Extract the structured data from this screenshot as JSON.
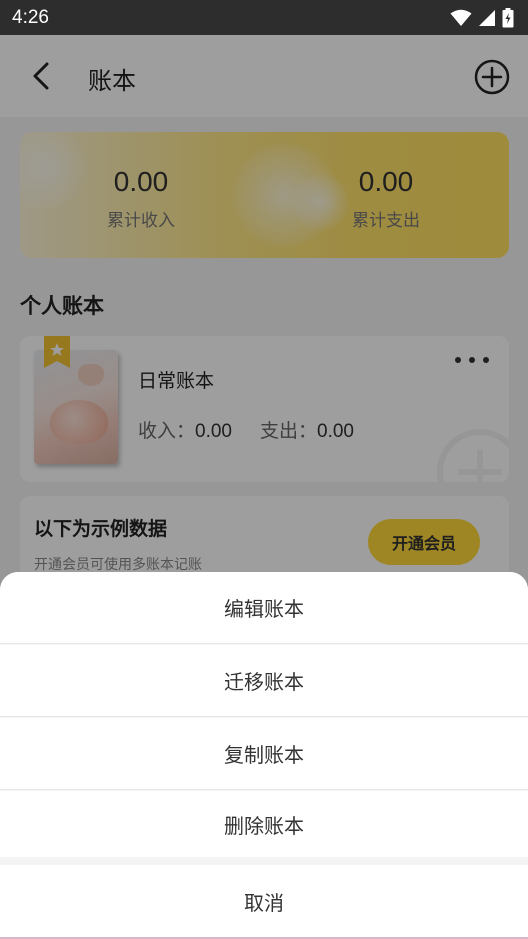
{
  "status_bar": {
    "time": "4:26"
  },
  "header": {
    "title": "账本"
  },
  "summary": {
    "income_value": "0.00",
    "income_label": "累计收入",
    "expense_value": "0.00",
    "expense_label": "累计支出"
  },
  "section": {
    "title": "个人账本"
  },
  "book": {
    "name": "日常账本",
    "income_label": "收入：",
    "income_value": "0.00",
    "expense_label": "支出：",
    "expense_value": "0.00"
  },
  "example": {
    "title": "以下为示例数据",
    "subtitle": "开通会员可使用多账本记账",
    "vip_button": "开通会员"
  },
  "action_sheet": {
    "items": [
      "编辑账本",
      "迁移账本",
      "复制账本",
      "删除账本"
    ],
    "cancel": "取消"
  },
  "colors": {
    "accent_yellow": "#ffd83a",
    "status_bar": "#2d2d2d"
  },
  "icons": [
    "wifi-icon",
    "signal-icon",
    "battery-icon",
    "back-arrow-icon",
    "add-circle-icon",
    "star-icon",
    "more-icon"
  ]
}
